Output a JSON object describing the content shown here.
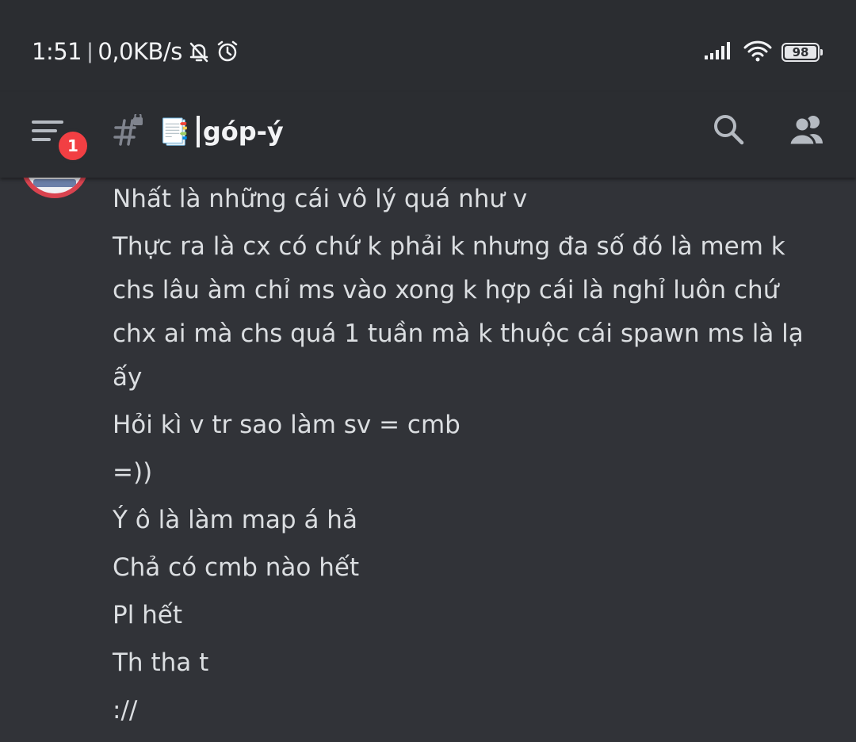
{
  "status_bar": {
    "time": "1:51",
    "speed": "0,0KB/s",
    "battery": "98",
    "icons": [
      "muted-bell-icon",
      "alarm-icon",
      "signal-icon",
      "wifi-icon",
      "battery-icon"
    ]
  },
  "header": {
    "notification_count": "1",
    "channel_prefix": "📑",
    "channel_name": "góp-ý",
    "icons": [
      "menu-icon",
      "locked-hash-icon",
      "search-icon",
      "members-icon"
    ]
  },
  "messages": [
    "Nhất là những cái vô lý quá như v",
    "Thực ra là cx có chứ k phải k nhưng đa số đó là mem k chs lâu àm chỉ ms vào xong k hợp cái là nghỉ luôn chứ chx ai mà chs quá 1 tuần mà k thuộc cái spawn ms là lạ ấy",
    "Hỏi kì v tr sao làm sv = cmb",
    "=))",
    "Ý ô là làm map á hả",
    "Chả có cmb nào hết",
    "Pl hết",
    "Th tha t",
    "://"
  ],
  "colors": {
    "background": "#313338",
    "topbar": "#2b2d31",
    "text": "#dbdee1",
    "badge": "#f23f43"
  }
}
